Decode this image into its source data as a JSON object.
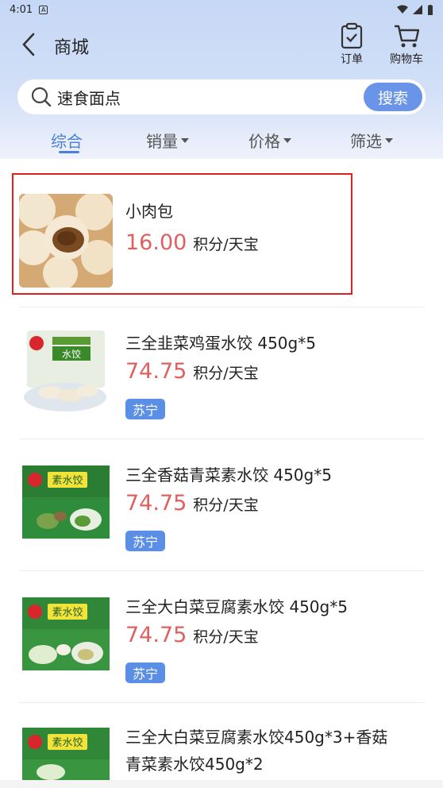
{
  "status": {
    "time": "4:01"
  },
  "header": {
    "title": "商城",
    "orders_label": "订单",
    "cart_label": "购物车"
  },
  "search": {
    "query": "速食面点",
    "button_label": "搜索"
  },
  "sort_tabs": [
    {
      "label": "综合",
      "active": true
    },
    {
      "label": "销量",
      "active": false
    },
    {
      "label": "价格",
      "active": false
    },
    {
      "label": "筛选",
      "active": false
    }
  ],
  "products": [
    {
      "name": "小肉包",
      "price": "16.00",
      "unit": "积分/天宝",
      "badge": ""
    },
    {
      "name": "三全韭菜鸡蛋水饺 450g*5",
      "price": "74.75",
      "unit": "积分/天宝",
      "badge": "苏宁"
    },
    {
      "name": "三全香菇青菜素水饺 450g*5",
      "price": "74.75",
      "unit": "积分/天宝",
      "badge": "苏宁"
    },
    {
      "name": "三全大白菜豆腐素水饺 450g*5",
      "price": "74.75",
      "unit": "积分/天宝",
      "badge": "苏宁"
    },
    {
      "name_line1": "三全大白菜豆腐素水饺450g*3+香菇",
      "name_line2": "青菜素水饺450g*2"
    }
  ],
  "colors": {
    "accent": "#5b8fe6",
    "price": "#e06060",
    "highlight": "#e02020"
  }
}
